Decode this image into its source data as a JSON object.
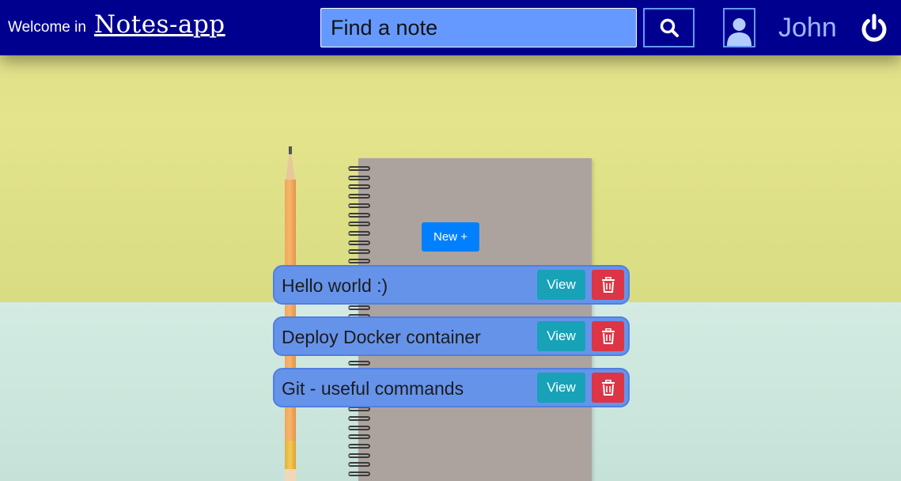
{
  "header": {
    "welcome_text": "Welcome in",
    "brand": "Notes-app",
    "search_placeholder": "Find a note",
    "search_icon": "search-icon",
    "avatar_icon": "user-avatar-icon",
    "username": "John",
    "logout_icon": "power-icon"
  },
  "main": {
    "new_button_label": "New +",
    "notes": [
      {
        "title": "Hello world :)",
        "view_label": "View",
        "delete_icon": "trash-icon"
      },
      {
        "title": "Deploy Docker container",
        "view_label": "View",
        "delete_icon": "trash-icon"
      },
      {
        "title": "Git - useful commands",
        "view_label": "View",
        "delete_icon": "trash-icon"
      }
    ]
  },
  "colors": {
    "header_bg": "#00008f",
    "search_bg": "#6699ff",
    "new_button": "#0080ff",
    "note_bg": "#6693ea",
    "view_button": "#17a2b8",
    "delete_button": "#dc3545"
  }
}
